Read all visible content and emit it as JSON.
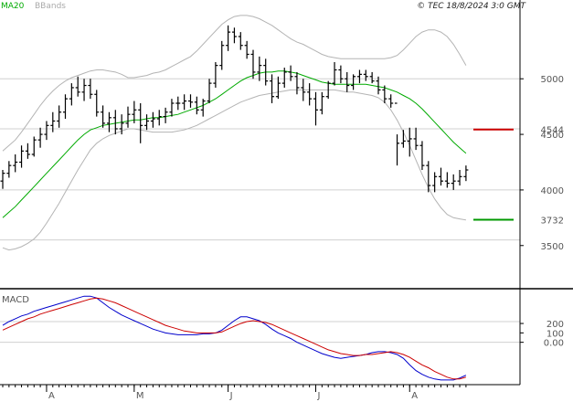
{
  "header": {
    "legend": [
      {
        "label": "MA20",
        "color": "#00aa00"
      },
      {
        "label": "BBands",
        "color": "#aaaaaa"
      }
    ],
    "timestamp": "© TEC 18/8/2024 3:0 GMT"
  },
  "chart_data": {
    "type": "ohlc",
    "price_panel": {
      "ylim": [
        3120,
        5610
      ],
      "y_ticks": [
        {
          "value": 5000,
          "label": "5000"
        },
        {
          "value": 4500,
          "label": "4500"
        },
        {
          "value": 4000,
          "label": "4000"
        },
        {
          "value": 3500,
          "label": "3500"
        }
      ],
      "gridlines": [
        5000,
        4550,
        4000,
        3550
      ],
      "price_levels": [
        {
          "name": "resistance",
          "value": 4544,
          "label": "4544",
          "color": "#cc0000"
        },
        {
          "name": "support",
          "value": 3732,
          "label": "3732",
          "color": "#009900"
        }
      ],
      "colors": {
        "bars": "#000000",
        "ma": "#00aa00",
        "bbands": "#b4b4b4"
      },
      "ohlc": [
        [
          4080,
          4180,
          4010,
          4150
        ],
        [
          4150,
          4260,
          4110,
          4220
        ],
        [
          4220,
          4320,
          4160,
          4250
        ],
        [
          4250,
          4400,
          4200,
          4350
        ],
        [
          4350,
          4420,
          4280,
          4320
        ],
        [
          4320,
          4480,
          4300,
          4450
        ],
        [
          4450,
          4560,
          4380,
          4500
        ],
        [
          4500,
          4620,
          4450,
          4580
        ],
        [
          4580,
          4700,
          4520,
          4620
        ],
        [
          4620,
          4760,
          4560,
          4700
        ],
        [
          4700,
          4860,
          4640,
          4820
        ],
        [
          4820,
          4960,
          4760,
          4920
        ],
        [
          4920,
          5020,
          4840,
          4880
        ],
        [
          4880,
          5000,
          4800,
          4940
        ],
        [
          4940,
          5000,
          4820,
          4860
        ],
        [
          4860,
          4900,
          4660,
          4700
        ],
        [
          4700,
          4760,
          4560,
          4600
        ],
        [
          4600,
          4700,
          4520,
          4650
        ],
        [
          4650,
          4720,
          4500,
          4550
        ],
        [
          4550,
          4680,
          4500,
          4600
        ],
        [
          4600,
          4750,
          4560,
          4680
        ],
        [
          4680,
          4800,
          4600,
          4720
        ],
        [
          4720,
          4780,
          4420,
          4580
        ],
        [
          4580,
          4680,
          4540,
          4620
        ],
        [
          4620,
          4700,
          4560,
          4640
        ],
        [
          4640,
          4720,
          4580,
          4660
        ],
        [
          4660,
          4740,
          4600,
          4700
        ],
        [
          4700,
          4820,
          4660,
          4780
        ],
        [
          4780,
          4840,
          4720,
          4780
        ],
        [
          4780,
          4860,
          4720,
          4800
        ],
        [
          4800,
          4860,
          4740,
          4790
        ],
        [
          4790,
          4840,
          4680,
          4720
        ],
        [
          4720,
          4820,
          4660,
          4800
        ],
        [
          4800,
          5000,
          4780,
          4960
        ],
        [
          4960,
          5150,
          4920,
          5120
        ],
        [
          5120,
          5340,
          5080,
          5300
        ],
        [
          5300,
          5480,
          5250,
          5420
        ],
        [
          5420,
          5460,
          5320,
          5380
        ],
        [
          5380,
          5420,
          5260,
          5300
        ],
        [
          5300,
          5340,
          5180,
          5220
        ],
        [
          5220,
          5260,
          5000,
          5060
        ],
        [
          5060,
          5200,
          4980,
          5120
        ],
        [
          5120,
          5180,
          4940,
          4980
        ],
        [
          4980,
          5040,
          4780,
          4840
        ],
        [
          4840,
          5020,
          4820,
          4960
        ],
        [
          4960,
          5100,
          4920,
          5060
        ],
        [
          5060,
          5120,
          4980,
          5020
        ],
        [
          5020,
          5060,
          4860,
          4920
        ],
        [
          4920,
          5000,
          4800,
          4880
        ],
        [
          4880,
          4960,
          4760,
          4820
        ],
        [
          4820,
          4880,
          4580,
          4720
        ],
        [
          4720,
          4880,
          4680,
          4840
        ],
        [
          4840,
          4980,
          4820,
          4960
        ],
        [
          4960,
          5150,
          4940,
          5080
        ],
        [
          5080,
          5120,
          4960,
          5000
        ],
        [
          5000,
          5060,
          4880,
          4940
        ],
        [
          4940,
          5040,
          4900,
          5020
        ],
        [
          5020,
          5080,
          4960,
          5040
        ],
        [
          5040,
          5080,
          4980,
          5020
        ],
        [
          5020,
          5060,
          4960,
          4980
        ],
        [
          4980,
          5020,
          4860,
          4900
        ],
        [
          4900,
          4940,
          4780,
          4820
        ],
        [
          4820,
          4860,
          4740,
          4780
        ],
        [
          4780,
          4500,
          4220,
          4420
        ],
        [
          4420,
          4540,
          4380,
          4440
        ],
        [
          4440,
          4560,
          4300,
          4460
        ],
        [
          4460,
          4560,
          4360,
          4400
        ],
        [
          4400,
          4440,
          4180,
          4220
        ],
        [
          4220,
          4260,
          3980,
          4040
        ],
        [
          4040,
          4160,
          3980,
          4120
        ],
        [
          4120,
          4200,
          4040,
          4080
        ],
        [
          4080,
          4160,
          4020,
          4060
        ],
        [
          4060,
          4140,
          4000,
          4080
        ],
        [
          4080,
          4180,
          4040,
          4120
        ],
        [
          4120,
          4220,
          4080,
          4180
        ]
      ],
      "ma20": [
        3750,
        3800,
        3850,
        3910,
        3970,
        4030,
        4090,
        4150,
        4210,
        4270,
        4330,
        4390,
        4450,
        4500,
        4540,
        4560,
        4580,
        4590,
        4600,
        4610,
        4620,
        4630,
        4630,
        4640,
        4650,
        4650,
        4660,
        4670,
        4680,
        4700,
        4720,
        4740,
        4760,
        4790,
        4820,
        4860,
        4900,
        4940,
        4980,
        5010,
        5030,
        5050,
        5060,
        5060,
        5070,
        5070,
        5060,
        5050,
        5030,
        5010,
        4990,
        4970,
        4960,
        4950,
        4950,
        4950,
        4950,
        4950,
        4950,
        4940,
        4930,
        4920,
        4900,
        4880,
        4850,
        4820,
        4780,
        4730,
        4670,
        4610,
        4550,
        4490,
        4430,
        4380,
        4330
      ],
      "bb_upper": [
        4350,
        4400,
        4450,
        4520,
        4600,
        4680,
        4760,
        4830,
        4890,
        4940,
        4980,
        5010,
        5030,
        5050,
        5070,
        5080,
        5080,
        5070,
        5060,
        5040,
        5010,
        5010,
        5020,
        5030,
        5050,
        5060,
        5080,
        5110,
        5140,
        5170,
        5200,
        5250,
        5310,
        5370,
        5430,
        5490,
        5530,
        5560,
        5570,
        5570,
        5560,
        5540,
        5510,
        5480,
        5440,
        5400,
        5360,
        5330,
        5310,
        5280,
        5250,
        5220,
        5200,
        5190,
        5180,
        5180,
        5180,
        5180,
        5180,
        5180,
        5180,
        5180,
        5190,
        5210,
        5260,
        5320,
        5380,
        5420,
        5440,
        5440,
        5420,
        5380,
        5310,
        5220,
        5120
      ],
      "bb_lower": [
        3480,
        3460,
        3470,
        3490,
        3520,
        3560,
        3620,
        3700,
        3790,
        3880,
        3980,
        4080,
        4180,
        4270,
        4360,
        4420,
        4460,
        4490,
        4510,
        4530,
        4550,
        4550,
        4540,
        4530,
        4520,
        4520,
        4520,
        4520,
        4530,
        4540,
        4560,
        4580,
        4610,
        4640,
        4670,
        4700,
        4730,
        4760,
        4790,
        4810,
        4830,
        4850,
        4860,
        4870,
        4880,
        4890,
        4900,
        4900,
        4900,
        4900,
        4900,
        4900,
        4900,
        4900,
        4890,
        4880,
        4880,
        4870,
        4860,
        4850,
        4830,
        4790,
        4720,
        4630,
        4520,
        4400,
        4270,
        4140,
        4020,
        3920,
        3840,
        3780,
        3750,
        3740,
        3730
      ]
    },
    "macd_panel": {
      "title": "MACD",
      "ylim": [
        -450,
        550
      ],
      "y_ticks": [
        {
          "value": 200,
          "label": "200"
        },
        {
          "value": 100,
          "label": "100"
        },
        {
          "value": 0,
          "label": "0.00"
        }
      ],
      "gridlines": [
        220,
        0
      ],
      "colors": {
        "macd": "#0000cc",
        "signal": "#cc0000"
      },
      "macd": [
        180,
        220,
        250,
        280,
        300,
        330,
        350,
        370,
        390,
        410,
        430,
        450,
        470,
        490,
        490,
        470,
        420,
        370,
        330,
        290,
        260,
        230,
        200,
        170,
        140,
        120,
        100,
        90,
        80,
        80,
        80,
        80,
        90,
        90,
        100,
        130,
        180,
        230,
        270,
        270,
        250,
        230,
        190,
        140,
        100,
        70,
        40,
        0,
        -30,
        -60,
        -90,
        -120,
        -140,
        -160,
        -170,
        -160,
        -150,
        -140,
        -130,
        -110,
        -100,
        -100,
        -110,
        -130,
        -170,
        -240,
        -300,
        -340,
        -370,
        -390,
        -400,
        -400,
        -400,
        -380,
        -350
      ],
      "signal": [
        130,
        160,
        190,
        220,
        250,
        270,
        300,
        320,
        340,
        360,
        380,
        400,
        420,
        440,
        460,
        470,
        460,
        440,
        420,
        390,
        360,
        330,
        300,
        270,
        240,
        210,
        180,
        160,
        140,
        120,
        110,
        100,
        100,
        100,
        100,
        110,
        140,
        170,
        200,
        220,
        230,
        220,
        210,
        190,
        160,
        130,
        100,
        70,
        40,
        10,
        -20,
        -50,
        -80,
        -100,
        -120,
        -130,
        -140,
        -140,
        -130,
        -130,
        -120,
        -110,
        -100,
        -110,
        -130,
        -160,
        -200,
        -240,
        -270,
        -310,
        -340,
        -370,
        -390,
        -390,
        -370
      ]
    },
    "x_axis": {
      "months": [
        {
          "index": 7,
          "label": "A"
        },
        {
          "index": 21,
          "label": "M"
        },
        {
          "index": 36,
          "label": "J"
        },
        {
          "index": 50,
          "label": "J"
        },
        {
          "index": 65,
          "label": "A"
        }
      ]
    }
  }
}
